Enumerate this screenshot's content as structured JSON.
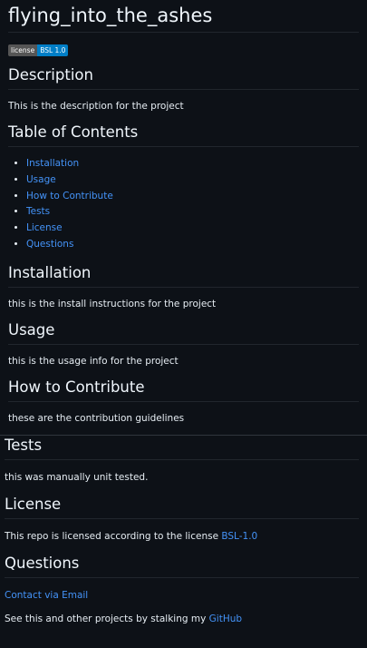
{
  "title": "flying_into_the_ashes",
  "badge": {
    "label": "license",
    "value": "BSL 1.0"
  },
  "description": {
    "heading": "Description",
    "text": "This is the description for the project"
  },
  "toc": {
    "heading": "Table of Contents",
    "items": [
      "Installation",
      "Usage",
      "How to Contribute",
      "Tests",
      "License",
      "Questions"
    ]
  },
  "installation": {
    "heading": "Installation",
    "text": "this is the install instructions for the project"
  },
  "usage": {
    "heading": "Usage",
    "text": "this is the usage info for the project"
  },
  "contribute": {
    "heading": "How to Contribute",
    "text": "these are the contribution guidelines"
  },
  "tests": {
    "heading": "Tests",
    "text": "this was manually unit tested."
  },
  "license": {
    "heading": "License",
    "text": "This repo is licensed according to the license",
    "link": "BSL-1.0"
  },
  "questions": {
    "heading": "Questions",
    "email_link": "Contact via Email",
    "github_text": "See this and other projects by stalking my",
    "github_link": "GitHub"
  },
  "colors": {
    "background": "#0d1117",
    "link": "#4493f8",
    "badge_label_bg": "#555555",
    "badge_value_bg": "#007ec6"
  }
}
